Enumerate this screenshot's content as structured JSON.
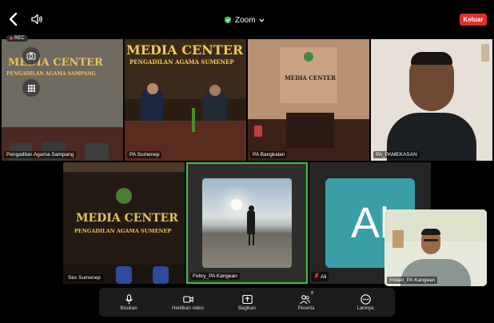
{
  "topbar": {
    "back_icon": "chevron-left-icon",
    "speaker_icon": "speaker-icon",
    "title": "Zoom",
    "title_icon": "shield-check-icon",
    "leave_label": "Keluar",
    "leave_color": "#e02f2f"
  },
  "rec_label": "REC",
  "tiles": [
    {
      "label": "Pengadilan Agama Sampang",
      "banner_1": "MEDIA CENTER",
      "banner_2": "PENGADILAN AGAMA SAMPANG"
    },
    {
      "label": "PA Sumenep",
      "banner_1": "MEDIA CENTER",
      "banner_2": "PENGADILAN AGAMA SUMENEP"
    },
    {
      "label": "PA Bangkalan",
      "banner_1": "MEDIA CENTER"
    },
    {
      "label": "PA_PAMEKASAN"
    },
    {
      "label": "Ses Sumenep",
      "banner_1": "MEDIA CENTER",
      "banner_2": "PENGADILAN AGAMA SUMENEP"
    },
    {
      "label": "Febry_PA Kangean"
    },
    {
      "label": "Ali",
      "avatar": "Al",
      "avatar_color": "#3a9ea6"
    },
    {
      "label": "Imdad_PA Kangean"
    }
  ],
  "toolbar": {
    "items": [
      {
        "label": "Bisukan",
        "icon": "microphone-icon"
      },
      {
        "label": "Hentikan video",
        "icon": "video-camera-icon"
      },
      {
        "label": "Bagikan",
        "icon": "share-screen-icon"
      },
      {
        "label": "Peserta",
        "icon": "participants-icon",
        "count": "8"
      },
      {
        "label": "Lainnya",
        "icon": "more-icon"
      }
    ]
  },
  "colors": {
    "active_speaker_border": "#3fbf4a",
    "toolbar_bg": "#1c1c1c"
  }
}
